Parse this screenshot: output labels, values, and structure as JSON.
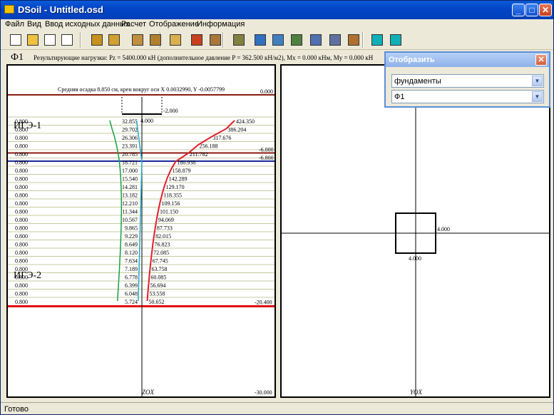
{
  "window": {
    "title": "DSoil - Untitled.osd",
    "minimize": "_",
    "maximize": "□",
    "close": "✕",
    "accent": "#0a5bd8"
  },
  "menu": [
    "Файл",
    "Вид",
    "Ввод исходных данных",
    "Расчет",
    "Отображение",
    "Информация"
  ],
  "toolbar": {
    "buttons": [
      {
        "icon": "new-file-icon",
        "color": "#ffffff"
      },
      {
        "icon": "open-folder-icon",
        "color": "#f0c040"
      },
      {
        "icon": "save-icon",
        "color": "#ffffff"
      },
      {
        "icon": "save-as-icon",
        "color": "#ffffff"
      },
      {
        "icon": "layers-icon",
        "color": "#c89020"
      },
      {
        "icon": "soil-profile-icon",
        "color": "#d0a030"
      },
      {
        "icon": "foundation-icon",
        "color": "#c09040"
      },
      {
        "icon": "pile-icon",
        "color": "#b08030"
      },
      {
        "icon": "load-icon",
        "color": "#d8b050"
      },
      {
        "icon": "layer-red-icon",
        "color": "#c84020"
      },
      {
        "icon": "layer-brown-icon",
        "color": "#a87838"
      },
      {
        "icon": "depth-icon",
        "color": "#808040"
      },
      {
        "icon": "calc-table-icon",
        "color": "#3070c0"
      },
      {
        "icon": "grid-table-icon",
        "color": "#4080c0"
      },
      {
        "icon": "chart-table-icon",
        "color": "#508040"
      },
      {
        "icon": "result-table-icon",
        "color": "#5070b0"
      },
      {
        "icon": "data-table-icon",
        "color": "#6070a0"
      },
      {
        "icon": "report-table-icon",
        "color": "#b07030"
      },
      {
        "icon": "display-icon",
        "color": "#10b0b8"
      },
      {
        "icon": "settings-icon",
        "color": "#10b0b8"
      }
    ]
  },
  "info": {
    "foundation": "Ф1",
    "loads_text": "Результирующие нагрузки: Pz = 5400.000 кН (дополнительное давление P = 362.500 кН/м2), Mx = 0.000 кНм, My = 0.000 кН"
  },
  "left_panel": {
    "summary": "Средняя осадка 8.850 см, крен вокруг оси X 0.0032990, Y -0.0057799",
    "axis_label": "ZOX",
    "top_level": "0.000",
    "base_level": "-2.000",
    "foundation_width": "4.000",
    "level_a": "-6.000",
    "level_b": "-6.800",
    "level_c": "-20.400",
    "bottom_level": "-30.000",
    "layer_labels": [
      "ИГЭ-1",
      "ИГЭ-2"
    ],
    "row_thickness": "0.800",
    "stress_zp": [
      32.855,
      29.702,
      26.306,
      23.391,
      20.785,
      18.721,
      17.0,
      15.54,
      14.281,
      13.182,
      12.21,
      11.344,
      10.567,
      9.865,
      9.229,
      8.649,
      8.12,
      7.634,
      7.189,
      6.778,
      6.399,
      6.048,
      5.724
    ],
    "stress_zg": [
      424.35,
      386.204,
      317.676,
      256.188,
      211.782,
      180.938,
      158.879,
      142.289,
      129.17,
      118.355,
      109.156,
      101.15,
      94.069,
      87.733,
      82.015,
      76.823,
      72.085,
      67.745,
      63.758,
      60.085,
      56.694,
      53.558,
      50.652
    ],
    "colors": {
      "zg_curve": "#e0202c",
      "zp_curve": "#18a040",
      "cyan_curve": "#20a8c8",
      "row_line": "#c8c8a0",
      "layer_line": "#8b1a10",
      "water_line": "#1a2a9a",
      "bottom_line": "#e01010"
    }
  },
  "right_panel": {
    "axis_label": "YOX",
    "plan_width": "4.000",
    "plan_height": "4.000"
  },
  "popup": {
    "title": "Отобразить",
    "close": "✕",
    "select1": "фундаменты",
    "select2": "Ф1"
  },
  "status": "Готово"
}
